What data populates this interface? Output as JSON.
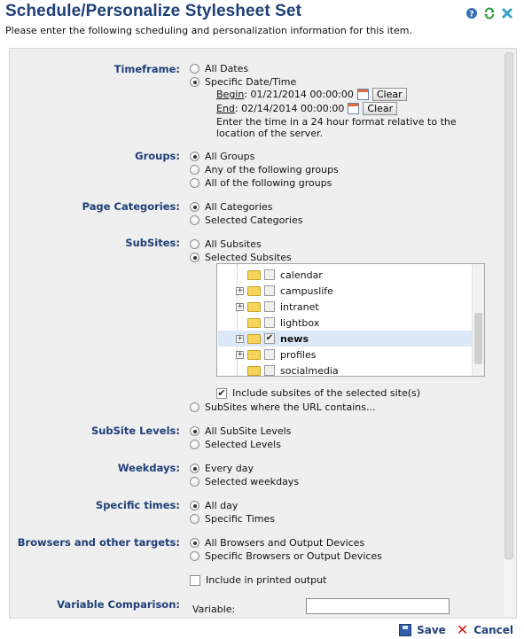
{
  "header": {
    "title": "Schedule/Personalize Stylesheet Set",
    "subtitle": "Please enter the following scheduling and personalization information for this item.",
    "icons": [
      "help-icon",
      "refresh-icon",
      "close-icon"
    ]
  },
  "timeframe": {
    "label": "Timeframe:",
    "options": [
      "All Dates",
      "Specific Date/Time"
    ],
    "selected": "Specific Date/Time",
    "begin_label": "Begin",
    "begin_value": ": 01/21/2014 00:00:00",
    "end_label": "End",
    "end_value": ": 02/14/2014 00:00:00",
    "clear_label": "Clear",
    "note": "Enter the time in a 24 hour format relative to the location of the server."
  },
  "groups": {
    "label": "Groups:",
    "options": [
      "All Groups",
      "Any of the following groups",
      "All of the following groups"
    ],
    "selected": "All Groups"
  },
  "page_categories": {
    "label": "Page Categories:",
    "options": [
      "All Categories",
      "Selected Categories"
    ],
    "selected": "All Categories"
  },
  "subsites": {
    "label": "SubSites:",
    "options": [
      "All Subsites",
      "Selected Subsites"
    ],
    "selected": "Selected Subsites",
    "tree": [
      {
        "name": "calendar",
        "expandable": false,
        "checked": false,
        "selected": false
      },
      {
        "name": "campuslife",
        "expandable": true,
        "checked": false,
        "selected": false
      },
      {
        "name": "intranet",
        "expandable": true,
        "checked": false,
        "selected": false
      },
      {
        "name": "lightbox",
        "expandable": false,
        "checked": false,
        "selected": false
      },
      {
        "name": "news",
        "expandable": true,
        "checked": true,
        "selected": true
      },
      {
        "name": "profiles",
        "expandable": true,
        "checked": false,
        "selected": false
      },
      {
        "name": "socialmedia",
        "expandable": false,
        "checked": false,
        "selected": false
      }
    ],
    "include_label": "Include subsites of the selected site(s)",
    "include_checked": true,
    "url_option": "SubSites where the URL contains..."
  },
  "subsite_levels": {
    "label": "SubSite Levels:",
    "options": [
      "All SubSite Levels",
      "Selected Levels"
    ],
    "selected": "All SubSite Levels"
  },
  "weekdays": {
    "label": "Weekdays:",
    "options": [
      "Every day",
      "Selected weekdays"
    ],
    "selected": "Every day"
  },
  "specific_times": {
    "label": "Specific times:",
    "options": [
      "All day",
      "Specific Times"
    ],
    "selected": "All day"
  },
  "browsers": {
    "label": "Browsers and other targets:",
    "options": [
      "All Browsers and Output Devices",
      "Specific Browsers or Output Devices"
    ],
    "selected": "All Browsers and Output Devices",
    "include_printed": "Include in printed output",
    "include_printed_checked": false
  },
  "variable_comparison": {
    "label": "Variable Comparison:",
    "variable_label": "Variable:",
    "variable_value": ""
  },
  "footer": {
    "save_label": "Save",
    "cancel_label": "Cancel"
  }
}
